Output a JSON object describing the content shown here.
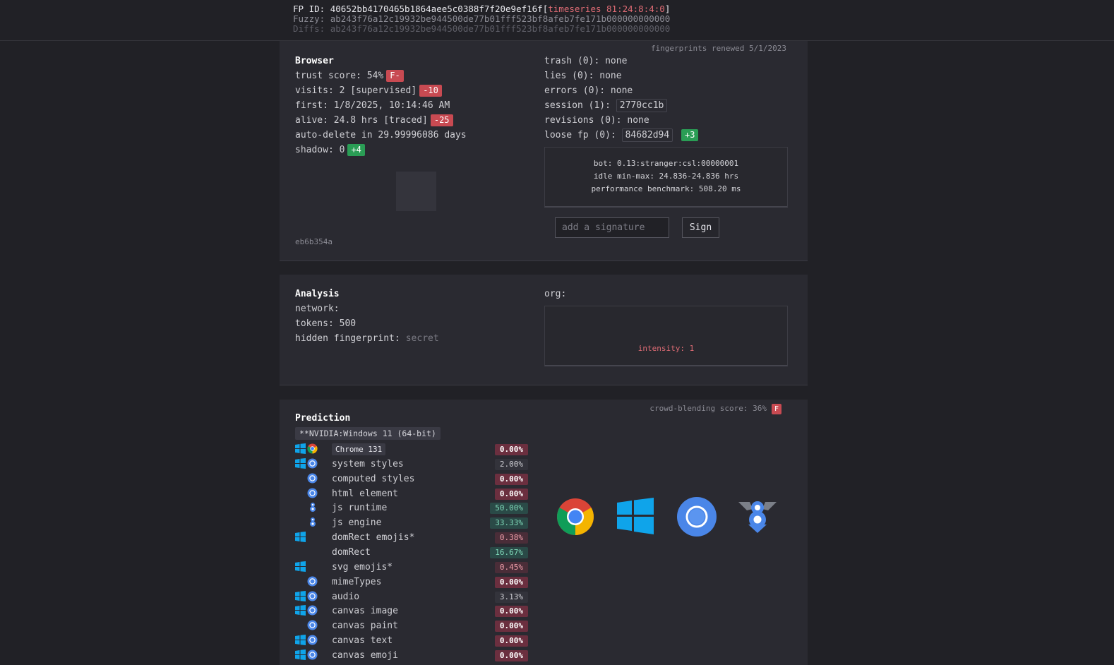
{
  "header": {
    "fp_id_label": "FP ID:",
    "fp_id": "40652bb4170465b1864aee5c0388f7f20e9ef16f",
    "timeseries": "timeseries 81:24:8:4:0",
    "fuzzy_label": "Fuzzy:",
    "fuzzy": "ab243f76a12c19932be944500de77b01fff523bf8afeb7fe171b000000000000",
    "diffs_label": "Diffs:",
    "diffs": "ab243f76a12c19932be944500de77b01fff523bf8afeb7fe171b000000000000"
  },
  "browser": {
    "title": "Browser",
    "renewed": "fingerprints renewed 5/1/2023",
    "trust_score": "trust score: 54%",
    "trust_grade": "F-",
    "visits": "visits: 2 [supervised]",
    "visits_badge": "-10",
    "first": "first: 1/8/2025, 10:14:46 AM",
    "alive": "alive: 24.8 hrs [traced]",
    "alive_badge": "-25",
    "auto_delete": "auto-delete in 29.99996086 days",
    "shadow": "shadow: 0",
    "shadow_badge": "+4",
    "hash": "eb6b354a",
    "trash": "trash (0): none",
    "lies": "lies (0): none",
    "errors": "errors (0): none",
    "session_label": "session (1):",
    "session_value": "2770cc1b",
    "revisions": "revisions (0): none",
    "loose_fp_label": "loose fp (0):",
    "loose_fp_value": "84682d94",
    "loose_fp_badge": "+3",
    "bot": "bot: 0.13:stranger:csl:00000001",
    "idle": "idle min-max: 24.836-24.836 hrs",
    "benchmark": "performance benchmark: 508.20 ms",
    "signature_placeholder": "add a signature",
    "sign_button": "Sign"
  },
  "analysis": {
    "title": "Analysis",
    "network": "network:",
    "tokens": "tokens: 500",
    "hidden_fp": "hidden fingerprint:",
    "secret": "secret",
    "org": "org:",
    "intensity": "intensity: 1"
  },
  "prediction": {
    "title": "Prediction",
    "crowd_score": "crowd-blending score: 36%",
    "crowd_grade": "F",
    "platform": "**NVIDIA:Windows 11 (64-bit)",
    "rows": [
      {
        "label": "Chrome 131",
        "pct": "0.00%",
        "style": "zero",
        "icons": [
          "windows",
          "chrome"
        ],
        "chip": true
      },
      {
        "label": "system styles",
        "pct": "2.00%",
        "style": "gray",
        "icons": [
          "windows",
          "blink"
        ]
      },
      {
        "label": "computed styles",
        "pct": "0.00%",
        "style": "zero",
        "icons": [
          "blink"
        ]
      },
      {
        "label": "html element",
        "pct": "0.00%",
        "style": "zero",
        "icons": [
          "blink"
        ]
      },
      {
        "label": "js runtime",
        "pct": "50.00%",
        "style": "green",
        "icons": [
          "v8"
        ]
      },
      {
        "label": "js engine",
        "pct": "33.33%",
        "style": "green",
        "icons": [
          "v8"
        ]
      },
      {
        "label": "domRect emojis*",
        "pct": "0.38%",
        "style": "pink",
        "icons": [
          "windows"
        ]
      },
      {
        "label": "domRect",
        "pct": "16.67%",
        "style": "green",
        "icons": []
      },
      {
        "label": "svg emojis*",
        "pct": "0.45%",
        "style": "pink",
        "icons": [
          "windows"
        ]
      },
      {
        "label": "mimeTypes",
        "pct": "0.00%",
        "style": "zero",
        "icons": [
          "blink"
        ]
      },
      {
        "label": "audio",
        "pct": "3.13%",
        "style": "gray",
        "icons": [
          "windows",
          "blink"
        ]
      },
      {
        "label": "canvas image",
        "pct": "0.00%",
        "style": "zero",
        "icons": [
          "windows",
          "blink"
        ]
      },
      {
        "label": "canvas paint",
        "pct": "0.00%",
        "style": "zero",
        "icons": [
          "blink"
        ]
      },
      {
        "label": "canvas text",
        "pct": "0.00%",
        "style": "zero",
        "icons": [
          "windows",
          "blink"
        ]
      },
      {
        "label": "canvas emoji",
        "pct": "0.00%",
        "style": "zero",
        "icons": [
          "windows",
          "blink"
        ]
      }
    ],
    "big_icons": [
      "chrome-logo-icon",
      "windows-logo-icon",
      "blink-engine-icon",
      "v8-engine-icon"
    ]
  },
  "colors": {
    "accent_red": "#e06c75",
    "badge_red": "#c84a52",
    "badge_green": "#2a9d55",
    "windows_blue": "#0fa4ea",
    "blink_blue": "#4a86e8"
  }
}
